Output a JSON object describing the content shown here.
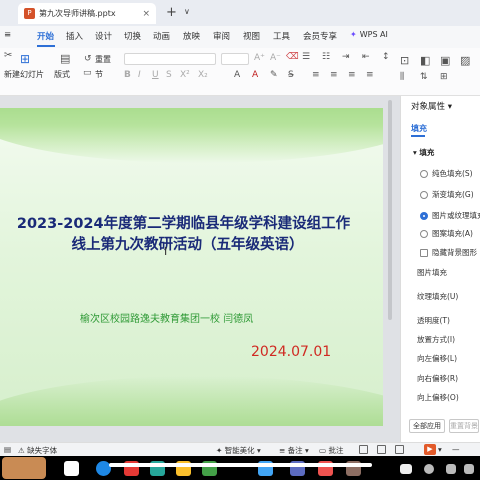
{
  "window": {
    "tab_title": "第九次导师讲稿.pptx",
    "tab_close": "×",
    "new_tab": "+",
    "tab_menu": "∨"
  },
  "ribbon_tabs": [
    "开始",
    "插入",
    "设计",
    "切换",
    "动画",
    "放映",
    "审阅",
    "视图",
    "工具",
    "会员专享"
  ],
  "active_tab": "开始",
  "wps_ai": {
    "label": "WPS AI",
    "icon": "✦"
  },
  "toolbar": {
    "new_slide": "新建幻灯片",
    "layout": "版式",
    "section": "节",
    "reset": "重置",
    "text_align_glyphs": [
      "≡",
      "≡",
      "≡",
      "≡"
    ]
  },
  "slide": {
    "title_line1": "2023-2024年度第二学期临县年级学科建设组工作",
    "title_line2": "线上第九次教研活动（五年级英语）",
    "subtitle": "榆次区校园路逸夫教育集团一校     闫德凤",
    "date": "2024.07.01",
    "colors": {
      "title": "#1a2a78",
      "subtitle": "#2f9a36",
      "date": "#d02a22",
      "green": "#8fd070"
    }
  },
  "panel": {
    "header": "对象属性",
    "tab": "填充",
    "section": "填充",
    "options": [
      {
        "label": "纯色填充(S)",
        "selected": false
      },
      {
        "label": "渐变填充(G)",
        "selected": false
      },
      {
        "label": "图片或纹理填充",
        "selected": true
      },
      {
        "label": "图案填充(A)",
        "selected": false
      }
    ],
    "hide_bg": "隐藏背景图形",
    "labels": [
      "图片填充",
      "纹理填充(U)",
      "透明度(T)",
      "放置方式(I)",
      "向左偏移(L)",
      "向右偏移(R)",
      "向上偏移(O)"
    ],
    "apply_all": "全部应用",
    "reset_bg": "重置背景"
  },
  "statusbar": {
    "missing_font": "缺失字体",
    "beautify": "智能美化",
    "notes": "备注",
    "comments": "批注"
  }
}
